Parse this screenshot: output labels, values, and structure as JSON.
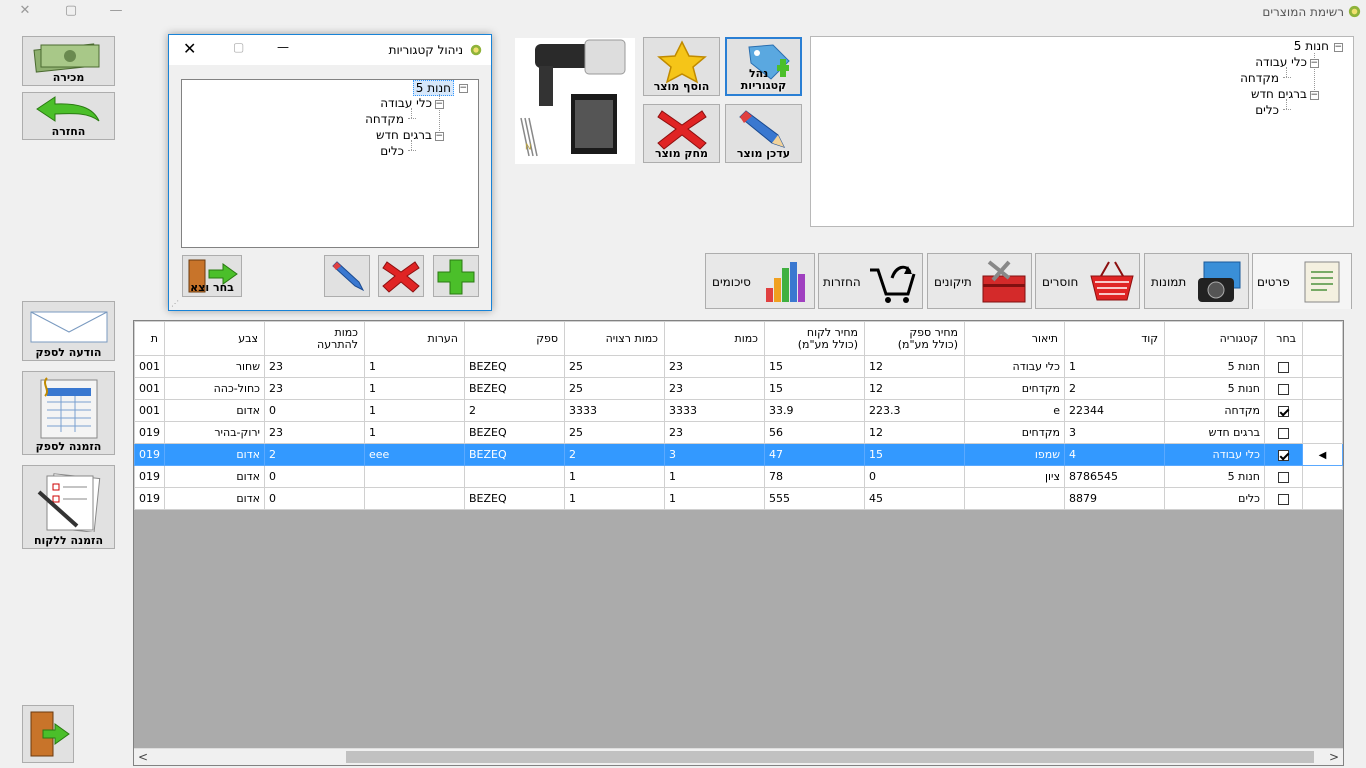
{
  "window": {
    "title": "רשימת המוצרים"
  },
  "tree": {
    "root": "חנות 5",
    "children": [
      "כלי עבודה",
      "מקדחה",
      "ברגים חדש",
      "כלים"
    ]
  },
  "toolbar": {
    "categories": "קטגוריות",
    "manage": "נהל",
    "add_product": "הוסף מוצר",
    "update_product": "עדכן מוצר",
    "delete_product": "מחק מוצר"
  },
  "tabs": [
    "פרטים",
    "תמונות",
    "חוסרים",
    "תיקונים",
    "החזרות",
    "סיכומים"
  ],
  "sidebar": {
    "sale": "מכירה",
    "return": "החזרה",
    "supplier_message": "הודעה לספק",
    "supplier_order": "הזמנה לספק",
    "customer_order": "הזמנה ללקוח"
  },
  "dialog": {
    "title": "ניהול קטגוריות",
    "select_exit": "בחר וצא"
  },
  "table": {
    "headers": [
      "בחר",
      "קטגוריה",
      "קוד",
      "תיאור",
      "מחיר ספק\n(כולל מע\"מ)",
      "מחיר לקוח\n(כולל מע\"מ)",
      "כמות",
      "כמות רצויה",
      "ספק",
      "הערות",
      "כמות\nלהתרעה",
      "צבע",
      "ת"
    ],
    "rows": [
      {
        "checked": false,
        "cells": [
          "חנות 5",
          "1",
          "כלי עבודה",
          "12",
          "15",
          "23",
          "25",
          "BEZEQ",
          "1",
          "23",
          "שחור",
          "001"
        ]
      },
      {
        "checked": false,
        "cells": [
          "חנות 5",
          "2",
          "מקדחים",
          "12",
          "15",
          "23",
          "25",
          "BEZEQ",
          "1",
          "23",
          "כחול-כהה",
          "001"
        ]
      },
      {
        "checked": true,
        "cells": [
          "מקדחה",
          "22344",
          "e",
          "223.3",
          "33.9",
          "3333",
          "3333",
          "2",
          "1",
          "0",
          "אדום",
          "001"
        ]
      },
      {
        "checked": false,
        "cells": [
          "ברגים חדש",
          "3",
          "מקדחים",
          "12",
          "56",
          "23",
          "25",
          "BEZEQ",
          "1",
          "23",
          "ירוק-בהיר",
          "019"
        ]
      },
      {
        "checked": true,
        "selected": true,
        "cells": [
          "כלי עבודה",
          "4",
          "שמפו",
          "15",
          "47",
          "3",
          "2",
          "BEZEQ",
          "eee",
          "2",
          "אדום",
          "019"
        ]
      },
      {
        "checked": false,
        "cells": [
          "חנות 5",
          "8786545",
          "ציון",
          "0",
          "78",
          "1",
          "1",
          "",
          "",
          "0",
          "אדום",
          "019"
        ]
      },
      {
        "checked": false,
        "cells": [
          "כלים",
          "8879",
          "",
          "45",
          "555",
          "1",
          "1",
          "BEZEQ",
          "",
          "0",
          "אדום",
          "019"
        ]
      }
    ]
  },
  "colors": {
    "selection": "#3399ff",
    "dialog_border": "#1883d7",
    "grid_bg": "#ababab"
  }
}
